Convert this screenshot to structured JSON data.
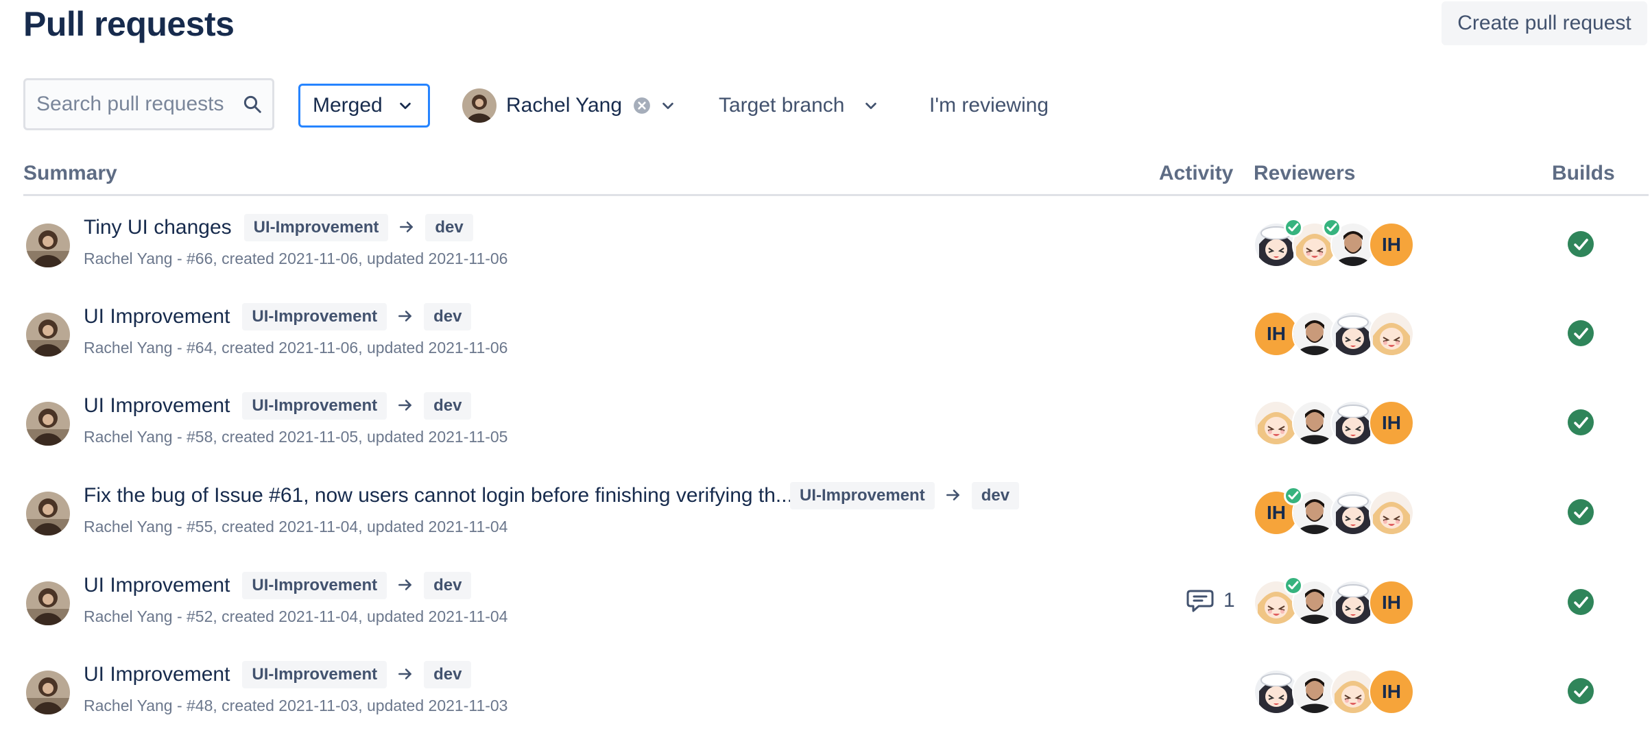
{
  "header": {
    "title": "Pull requests",
    "create_label": "Create pull request"
  },
  "filters": {
    "search_placeholder": "Search pull requests",
    "state": "Merged",
    "author": "Rachel Yang",
    "target_branch": "Target branch",
    "reviewing": "I'm reviewing"
  },
  "columns": {
    "summary": "Summary",
    "activity": "Activity",
    "reviewers": "Reviewers",
    "builds": "Builds"
  },
  "colors": {
    "accent": "#2684ff",
    "success": "#36b37e",
    "ih_avatar": "#f6a43a"
  },
  "rows": [
    {
      "title": "Tiny UI changes",
      "source": "UI-Improvement",
      "target": "dev",
      "meta": "Rachel Yang - #66, created 2021-11-06, updated 2021-11-06",
      "activity": "",
      "reviewers": [
        "maid",
        "blonde",
        "man",
        "IH"
      ],
      "approved": [
        0,
        1
      ],
      "reviewer_initials": "IH",
      "build": "passed"
    },
    {
      "title": "UI Improvement",
      "source": "UI-Improvement",
      "target": "dev",
      "meta": "Rachel Yang - #64, created 2021-11-06, updated 2021-11-06",
      "activity": "",
      "reviewers": [
        "IH",
        "man",
        "maid",
        "blonde"
      ],
      "approved": [],
      "reviewer_initials": "IH",
      "build": "passed"
    },
    {
      "title": "UI Improvement",
      "source": "UI-Improvement",
      "target": "dev",
      "meta": "Rachel Yang - #58, created 2021-11-05, updated 2021-11-05",
      "activity": "",
      "reviewers": [
        "blonde",
        "man",
        "maid",
        "IH"
      ],
      "approved": [],
      "reviewer_initials": "IH",
      "build": "passed"
    },
    {
      "title": "Fix the bug of Issue #61, now users cannot login before finishing verifying th...",
      "source": "UI-Improvement",
      "target": "dev",
      "meta": "Rachel Yang - #55, created 2021-11-04, updated 2021-11-04",
      "activity": "",
      "reviewers": [
        "IH",
        "man",
        "maid",
        "blonde"
      ],
      "approved": [
        0
      ],
      "reviewer_initials": "IH",
      "build": "passed"
    },
    {
      "title": "UI Improvement",
      "source": "UI-Improvement",
      "target": "dev",
      "meta": "Rachel Yang - #52, created 2021-11-04, updated 2021-11-04",
      "activity": "1",
      "reviewers": [
        "blonde",
        "man",
        "maid",
        "IH"
      ],
      "approved": [
        0
      ],
      "reviewer_initials": "IH",
      "build": "passed"
    },
    {
      "title": "UI Improvement",
      "source": "UI-Improvement",
      "target": "dev",
      "meta": "Rachel Yang - #48, created 2021-11-03, updated 2021-11-03",
      "activity": "",
      "reviewers": [
        "maid",
        "man",
        "blonde",
        "IH"
      ],
      "approved": [],
      "reviewer_initials": "IH",
      "build": "passed"
    }
  ]
}
